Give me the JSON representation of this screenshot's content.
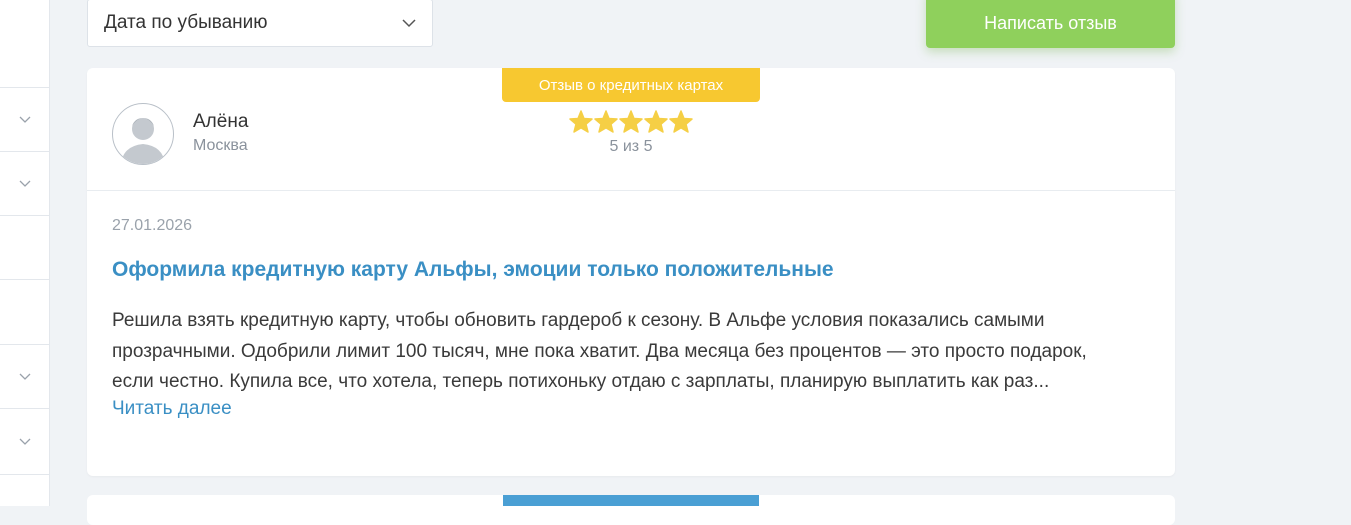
{
  "sort": {
    "selected": "Дата по убыванию"
  },
  "write_review": {
    "label": "Написать отзыв"
  },
  "review": {
    "category_badge": "Отзыв о кредитных картах",
    "author": {
      "name": "Алёна",
      "city": "Москва"
    },
    "rating": {
      "value": 5,
      "max": 5,
      "text": "5 из 5"
    },
    "date": "27.01.2026",
    "title": "Оформила кредитную карту Альфы, эмоции только положительные",
    "body_lines": [
      "Решила взять кредитную карту, чтобы обновить гардероб к сезону. В Альфе условия показались самыми",
      "прозрачными. Одобрили лимит 100 тысяч, мне пока хватит. Два месяца без процентов — это просто подарок,",
      "если честно. Купила все, что хотела, теперь потихоньку отдаю с зарплаты, планирую выплатить как раз..."
    ],
    "read_more": "Читать далее"
  },
  "colors": {
    "accent_green": "#8fd05c",
    "badge_yellow": "#f7c830",
    "badge_blue": "#4a9fd4",
    "link_blue": "#3a8fc4",
    "star": "#f5cf45"
  },
  "icons": {
    "sidebar_chevron": "chevron-down-icon",
    "select_chevron": "chevron-down-icon",
    "avatar": "user-avatar-icon",
    "star": "star-icon"
  }
}
